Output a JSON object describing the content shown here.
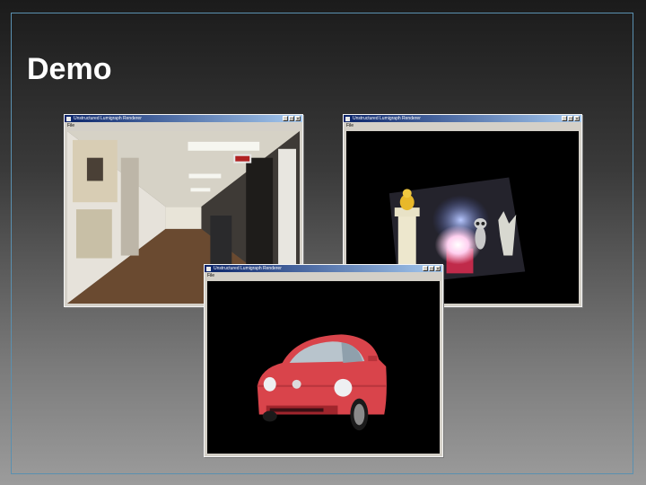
{
  "slide": {
    "title": "Demo"
  },
  "windows": [
    {
      "title": "Unstructured Lumigraph Renderer",
      "menu": "File"
    },
    {
      "title": "Unstructured Lumigraph Renderer",
      "menu": "File"
    },
    {
      "title": "Unstructured Lumigraph Renderer",
      "menu": "File"
    }
  ],
  "window_buttons": {
    "minimize": "_",
    "maximize": "□",
    "close": "×"
  },
  "colors": {
    "frame_border": "#5a90b0",
    "title_text": "#ffffff",
    "titlebar": "#0a246a",
    "car_red": "#d9444b"
  }
}
